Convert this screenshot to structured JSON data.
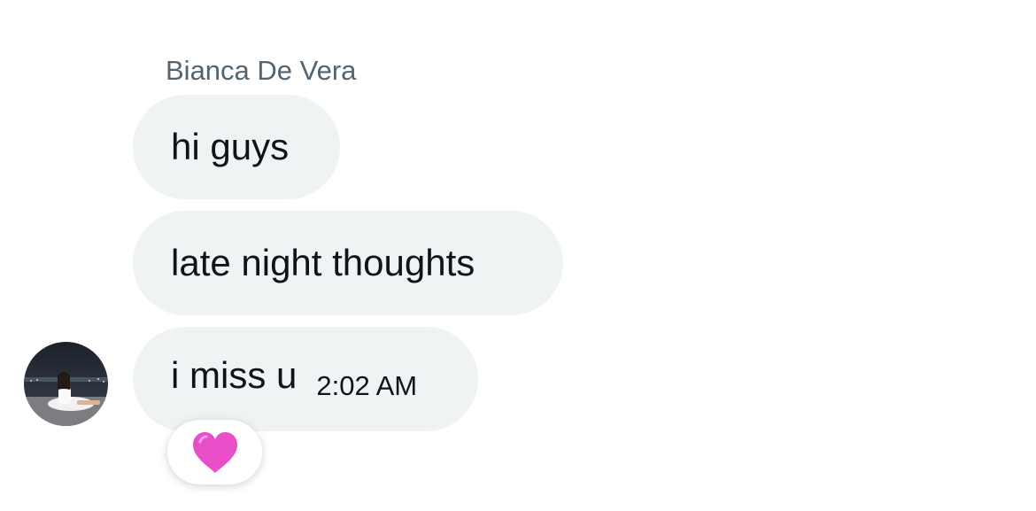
{
  "conversation": {
    "sender_name": "Bianca De Vera",
    "messages": [
      {
        "text": "hi guys"
      },
      {
        "text": "late night thoughts"
      },
      {
        "text": "i miss u",
        "timestamp": "2:02 AM"
      }
    ],
    "reaction": {
      "icon": "pink-heart-icon",
      "color": "#e94ec9"
    }
  },
  "colors": {
    "bubble_bg": "#eff3f4",
    "sender_name": "#536471",
    "text": "#0f1419"
  }
}
